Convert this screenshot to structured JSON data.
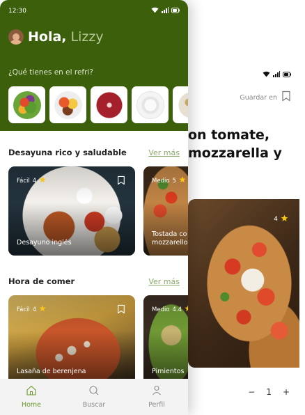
{
  "status_bar": {
    "time": "12:30"
  },
  "header": {
    "greeting": "Hola,",
    "user_name": "Lizzy",
    "fridge_question": "¿Qué tienes en el refri?"
  },
  "ingredients": [
    {
      "icon": "salad-bowl"
    },
    {
      "icon": "mixed-vegetables-plate"
    },
    {
      "icon": "raw-steak"
    },
    {
      "icon": "cream-bowl"
    },
    {
      "icon": "beans-bowl"
    }
  ],
  "sections": [
    {
      "title": "Desayuna rico y saludable",
      "see_more": "Ver más",
      "cards": [
        {
          "difficulty": "Fácil",
          "rating": "4",
          "name": "Desayuno inglés"
        },
        {
          "difficulty": "Medio",
          "rating": "5",
          "name": "Tostada co mozzarello"
        }
      ]
    },
    {
      "title": "Hora de comer",
      "see_more": "Ver más",
      "cards": [
        {
          "difficulty": "Fácil",
          "rating": "4",
          "name": "Lasaña de berenjena"
        },
        {
          "difficulty": "Medio",
          "rating": "4.4",
          "name": "Pimientos"
        }
      ]
    }
  ],
  "bottom_nav": [
    {
      "label": "Home",
      "icon": "home-icon",
      "active": true
    },
    {
      "label": "Buscar",
      "icon": "search-icon",
      "active": false
    },
    {
      "label": "Perfil",
      "icon": "profile-icon",
      "active": false
    }
  ],
  "detail": {
    "save_label": "Guardar en",
    "title_line1": "on tomate,",
    "title_line2": "mozzarella y",
    "rating": "4",
    "quantity": "1",
    "minus": "−",
    "plus": "+"
  },
  "colors": {
    "header_green": "#3b5f0a",
    "accent_green": "#6b9a2c",
    "star_yellow": "#f5c518"
  }
}
